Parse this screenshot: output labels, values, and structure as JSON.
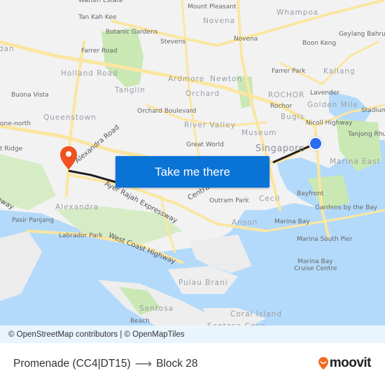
{
  "map": {
    "labels": {
      "watten_estate": "Watten Estate",
      "mount_pleasant": "Mount Pleasant",
      "whampoa": "Whampoa",
      "tan_kah_kee": "Tan Kah Kee",
      "novena_area": "Novena",
      "novena": "Novena",
      "geylang_bahru": "Geylang Bahru",
      "botanic_gardens": "Botanic Gardens",
      "stevens": "Stevens",
      "boon_keng": "Boon Keng",
      "dan": "dan",
      "farrer_road": "Farrer Road",
      "farrer_park": "Farrer Park",
      "kallang": "Kallang",
      "holland_road": "Holland Road",
      "ardmore": "Ardmore",
      "newton": "Newton",
      "buona_vista": "Buona Vista",
      "tanglin": "Tanglin",
      "orchard": "Orchard",
      "rochor_area": "ROCHOR",
      "lavender": "Lavender",
      "golden_mile": "Golden Mile",
      "rochor": "Rochor",
      "stadium": "Stadium",
      "orchard_boulevard": "Orchard Boulevard",
      "queenstown": "Queenstown",
      "bugis": "Bugis",
      "one_north": "one-north",
      "nicoll_highway": "Nicoll Highway",
      "river_valley": "River Valley",
      "museum": "Museum",
      "tanjong_rhu": "Tanjong Rhu",
      "kent_ridge": "t Ridge",
      "alexandra_road": "Alexandra Road",
      "great_world": "Great World",
      "singapore": "Singapore",
      "marina_east": "Marina East",
      "ayer_rajah": "Ayer Rajah Expressway",
      "central": "Central",
      "highway_left": "hway",
      "outram_park": "Outram Park",
      "cecil": "Cecil",
      "bayfront": "Bayfront",
      "alexandra": "Alexandra",
      "gardens_by_the_bay": "Gardens by the Bay",
      "pasir_panjang": "Pasir Panjang",
      "anson": "Anson",
      "marina_bay": "Marina Bay",
      "labrador_park": "Labrador Park",
      "marina_south_pier": "Marina South Pier",
      "west_coast_highway": "West Coast Highway",
      "marina_bay_cruise_centre_1": "Marina Bay",
      "marina_bay_cruise_centre_2": "Cruise Centre",
      "pulau_brani": "Pulau Brani",
      "sentosa": "Sentosa",
      "coral_island": "Coral Island",
      "beach": "Beach",
      "sentosa_cove": "Sentosa Cove"
    },
    "attribution": "© OpenStreetMap contributors | © OpenMapTiles",
    "cta_label": "Take me there",
    "colors": {
      "land": "#f2f2f3",
      "water": "#b3dafa",
      "park": "#c9e8b4",
      "road": "#fbe6a0",
      "route": "#1f1f1f",
      "origin": "#2b6cf0",
      "destination": "#f0511e",
      "cta": "#0a73d6"
    }
  },
  "footer": {
    "origin": "Promenade (CC4|DT15)",
    "arrow": "⟶",
    "destination": "Block 28",
    "brand": "moovit",
    "brand_color": "#f26a21"
  }
}
